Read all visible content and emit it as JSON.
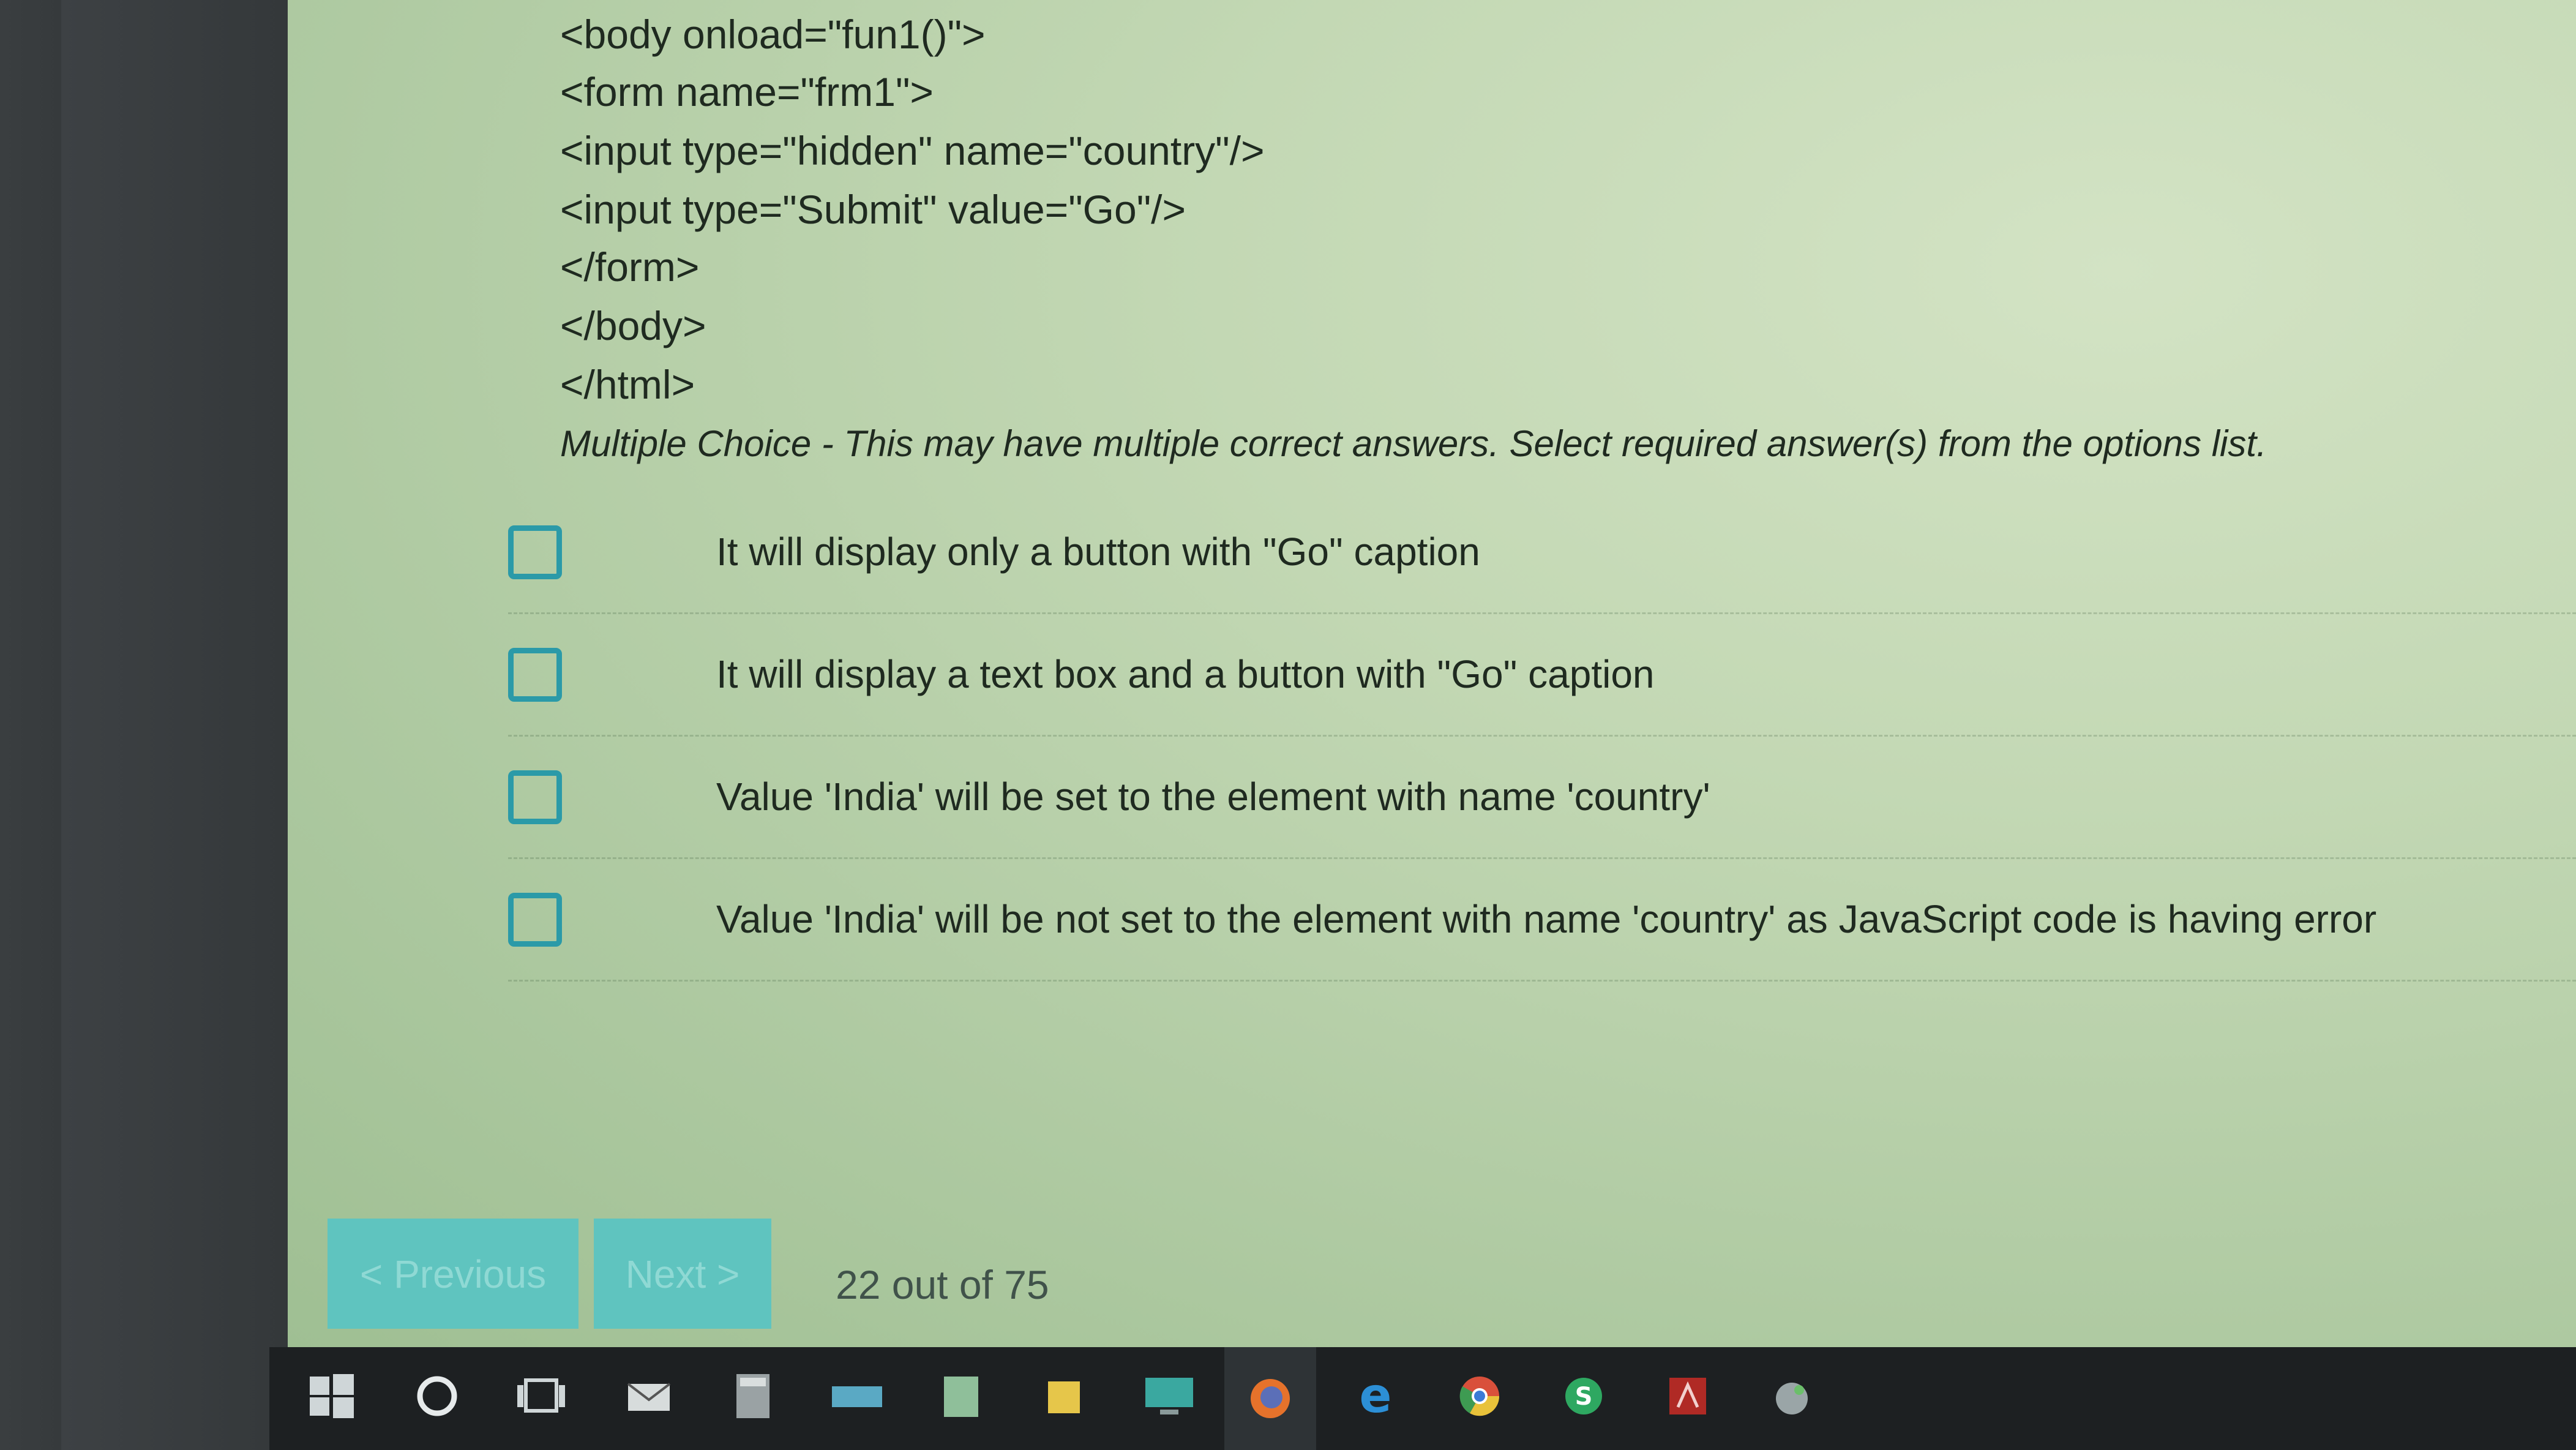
{
  "code_lines": [
    "<body onload=\"fun1()\">",
    "<form name=\"frm1\">",
    "<input type=\"hidden\" name=\"country\"/>",
    "<input type=\"Submit\" value=\"Go\"/>",
    "</form>",
    "</body>",
    "</html>"
  ],
  "instruction": "Multiple Choice - This may have multiple correct answers. Select required answer(s) from the options list.",
  "options": [
    {
      "label": "It will display only a button with \"Go\" caption",
      "checked": false
    },
    {
      "label": "It will display a text box and a button with \"Go\" caption",
      "checked": false
    },
    {
      "label": "Value 'India' will be set to the element with name 'country'",
      "checked": false
    },
    {
      "label": "Value 'India' will be not set to the element with name 'country' as JavaScript code is having error",
      "checked": false
    }
  ],
  "navigation": {
    "previous_label": "< Previous",
    "next_label": "Next >",
    "progress_text": "22 out of 75"
  },
  "taskbar": {
    "icons": [
      "windows-start-icon",
      "cortana-circle-icon",
      "task-view-icon",
      "mail-icon",
      "calculator-icon",
      "keyboard-icon",
      "notes-icon",
      "sticky-note-icon",
      "remote-desktop-icon",
      "firefox-icon",
      "edge-icon",
      "chrome-icon",
      "skype-icon",
      "acrobat-icon",
      "paint-icon"
    ]
  },
  "colors": {
    "accent": "#2b9aa8",
    "button_bg": "#5fc4bf",
    "screen_bg": "#c3d8b4",
    "taskbar_bg": "#1d2022"
  }
}
